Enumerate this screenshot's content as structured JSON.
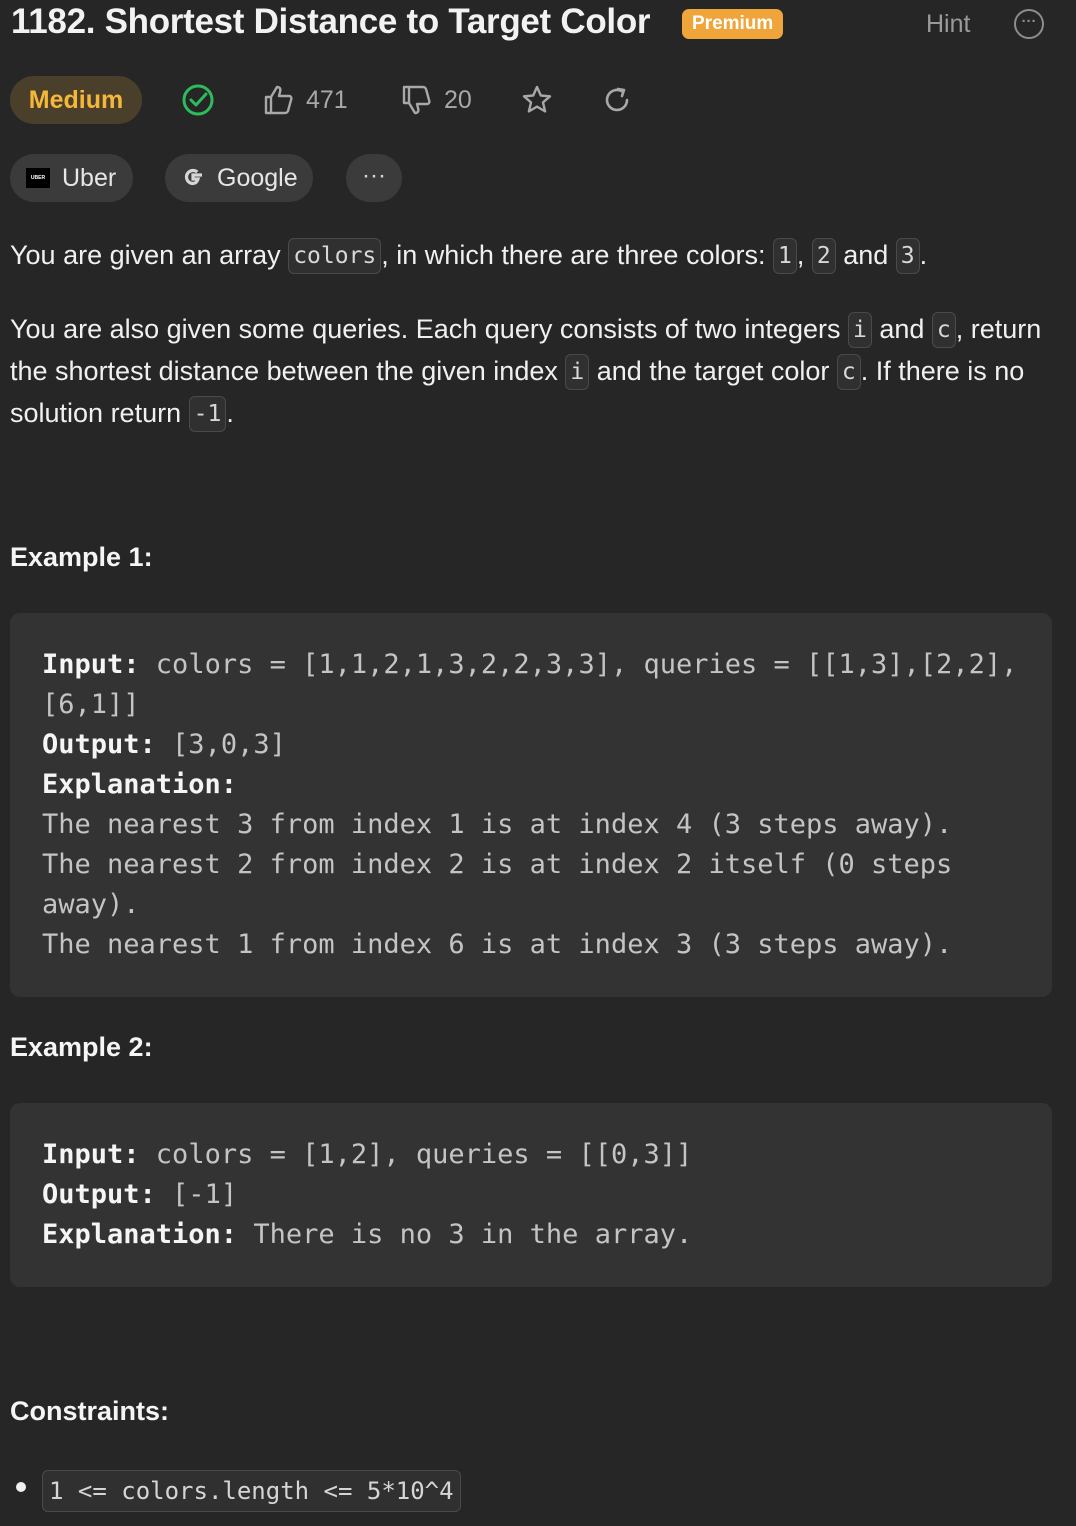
{
  "problem": {
    "title": "1182. Shortest Distance to Target Color",
    "premium_label": "Premium",
    "hint_label": "Hint",
    "difficulty": "Medium",
    "likes": "471",
    "dislikes": "20"
  },
  "companies": [
    {
      "name": "Uber",
      "logo_text": "UBER"
    },
    {
      "name": "Google"
    },
    {
      "name": "···"
    }
  ],
  "description": {
    "p1": {
      "t1": "You are given an array ",
      "c1": "colors",
      "t2": ", in which there are three colors: ",
      "c2": "1",
      "t3": ", ",
      "c3": "2",
      "t4": " and ",
      "c4": "3",
      "t5": "."
    },
    "p2": {
      "t1": "You are also given some queries. Each query consists of two integers ",
      "c1": "i",
      "t2": " and ",
      "c2": "c",
      "t3": ", return the shortest distance between the given index ",
      "c3": "i",
      "t4": " and the target color ",
      "c4": "c",
      "t5": ". If there is no solution return ",
      "c5": "-1",
      "t6": "."
    }
  },
  "examples": [
    {
      "heading": "Example 1:",
      "input_label": "Input:",
      "input_value": " colors = [1,1,2,1,3,2,2,3,3], queries = [[1,3],[2,2],[6,1]]",
      "output_label": "Output:",
      "output_value": " [3,0,3]",
      "explanation_label": "Explanation:",
      "explanation_lines": [
        "The nearest 3 from index 1 is at index 4 (3 steps away).",
        "The nearest 2 from index 2 is at index 2 itself (0 steps away).",
        "The nearest 1 from index 6 is at index 3 (3 steps away)."
      ]
    },
    {
      "heading": "Example 2:",
      "input_label": "Input:",
      "input_value": " colors = [1,2], queries = [[0,3]]",
      "output_label": "Output:",
      "output_value": " [-1]",
      "explanation_label": "Explanation:",
      "explanation_value": " There is no 3 in the array."
    }
  ],
  "constraints": {
    "heading": "Constraints:",
    "items": [
      "1 <= colors.length <= 5*10^4"
    ]
  },
  "icons": {
    "accepted": "check-circle-icon",
    "like": "thumbs-up-icon",
    "dislike": "thumbs-down-icon",
    "favorite": "star-icon",
    "share": "refresh-icon",
    "more": "ellipsis-circle-icon"
  },
  "colors": {
    "background": "#262626",
    "premium": "#f0a53a",
    "medium_text": "#f5b73a",
    "medium_bg": "#4a3f2b",
    "accepted_green": "#2cbb5d",
    "code_box": "#333333"
  }
}
